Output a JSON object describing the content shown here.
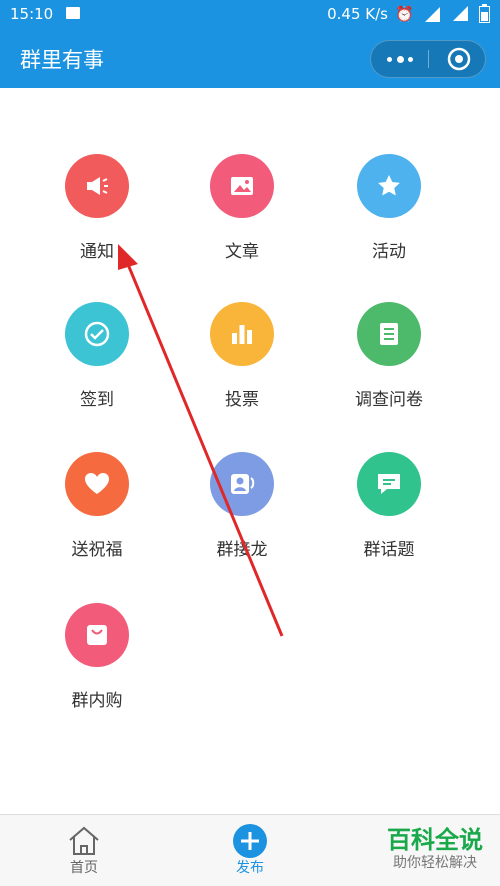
{
  "status_bar": {
    "time": "15:10",
    "speed": "0.45 K/s"
  },
  "app_bar": {
    "title": "群里有事"
  },
  "grid": {
    "items": [
      {
        "label": "通知",
        "icon": "megaphone-icon",
        "color": "#f25b5b"
      },
      {
        "label": "文章",
        "icon": "image-icon",
        "color": "#f25b7a"
      },
      {
        "label": "活动",
        "icon": "star-icon",
        "color": "#4eb2ee"
      },
      {
        "label": "签到",
        "icon": "check-icon",
        "color": "#3cc3d4"
      },
      {
        "label": "投票",
        "icon": "bar-chart-icon",
        "color": "#f9b43a"
      },
      {
        "label": "调查问卷",
        "icon": "document-icon",
        "color": "#4dba6b"
      },
      {
        "label": "送祝福",
        "icon": "heart-icon",
        "color": "#f56a3f"
      },
      {
        "label": "群接龙",
        "icon": "contacts-icon",
        "color": "#7e9ce3"
      },
      {
        "label": "群话题",
        "icon": "chat-icon",
        "color": "#30c38d"
      },
      {
        "label": "群内购",
        "icon": "bag-icon",
        "color": "#f25b7a"
      }
    ]
  },
  "tab_bar": {
    "home_label": "首页",
    "publish_label": "发布",
    "accent": "#1b93e0"
  },
  "watermark": {
    "main": "百科全说",
    "sub": "助你轻松解决"
  }
}
